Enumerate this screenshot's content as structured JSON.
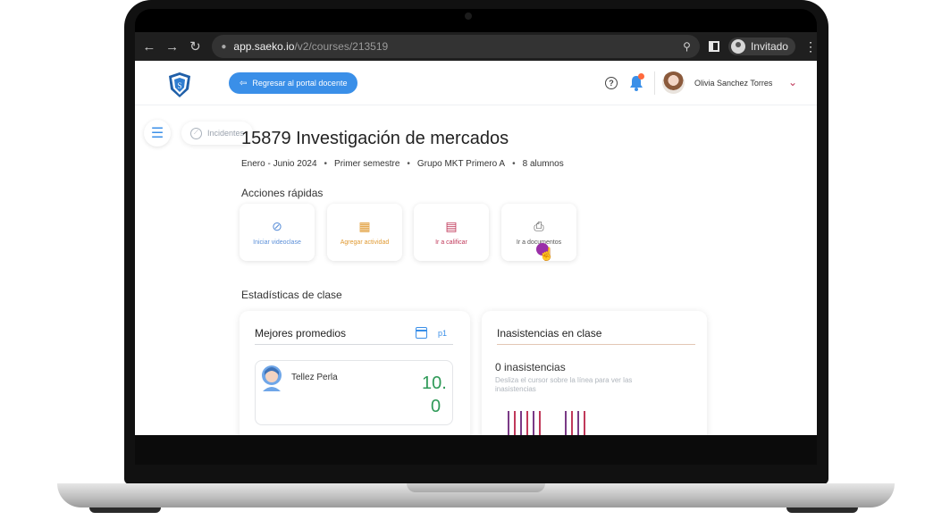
{
  "browser": {
    "url_host": "app.saeko.io",
    "url_path": "/v2/courses/213519",
    "profile_label": "Invitado",
    "nav": {
      "back": "←",
      "forward": "→",
      "reload": "↻"
    }
  },
  "header": {
    "portal_button_label": "Regresar al portal docente",
    "user_name": "Olivia Sanchez Torres",
    "notification_count": 1
  },
  "side": {
    "incidents_label": "Incidentes"
  },
  "course": {
    "title": "15879 Investigación de mercados",
    "period": "Enero - Junio 2024",
    "semester": "Primer semestre",
    "group": "Grupo MKT Primero A",
    "students": "8 alumnos"
  },
  "quick_actions": {
    "title": "Acciones rápidas",
    "items": [
      {
        "label": "Iniciar videoclase",
        "icon": "compass-icon"
      },
      {
        "label": "Agregar actividad",
        "icon": "activity-icon"
      },
      {
        "label": "Ir a calificar",
        "icon": "grade-icon"
      },
      {
        "label": "Ir a documentos",
        "icon": "printer-icon"
      }
    ]
  },
  "stats": {
    "title": "Estadísticas de clase",
    "best_averages": {
      "title": "Mejores promedios",
      "period": "p1",
      "student_name": "Tellez Perla",
      "score": "10.0"
    },
    "absences": {
      "title": "Inasistencias en clase",
      "count_text": "0 inasistencias",
      "hint": "Desliza el cursor sobre la línea para ver las inasistencias"
    }
  },
  "colors": {
    "primary": "#3a8fe8",
    "accent": "#c0395a",
    "success": "#2f9a58",
    "warning": "#e09a33"
  }
}
